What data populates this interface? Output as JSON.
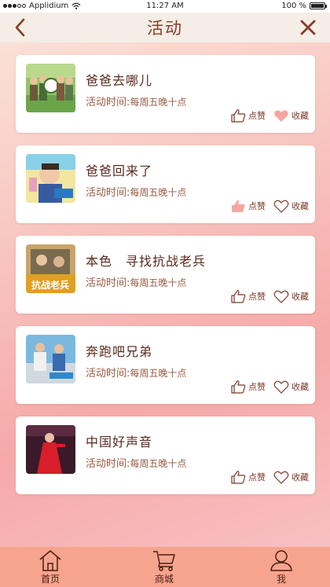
{
  "status_bar": {
    "carrier": "Applidium",
    "time": "11:27 AM",
    "battery": "100 %"
  },
  "header": {
    "title": "活动"
  },
  "activities": [
    {
      "title": "爸爸去哪儿",
      "time_label": "活动时间:",
      "time_value": "每周五晚十点",
      "like_label": "点赞",
      "fav_label": "收藏",
      "liked": false,
      "favorited": true
    },
    {
      "title": "爸爸回来了",
      "time_label": "活动时间:",
      "time_value": "每周五晚十点",
      "like_label": "点赞",
      "fav_label": "收藏",
      "liked": true,
      "favorited": false
    },
    {
      "title": "本色　寻找抗战老兵",
      "time_label": "活动时间:",
      "time_value": "每周五晚十点",
      "like_label": "点赞",
      "fav_label": "收藏",
      "liked": false,
      "favorited": false
    },
    {
      "title": "奔跑吧兄弟",
      "time_label": "活动时间:",
      "time_value": "每周五晚十点",
      "like_label": "点赞",
      "fav_label": "收藏",
      "liked": false,
      "favorited": false
    },
    {
      "title": "中国好声音",
      "time_label": "活动时间:",
      "time_value": "每周五晚十点",
      "like_label": "点赞",
      "fav_label": "收藏",
      "liked": false,
      "favorited": false
    }
  ],
  "thumb_text": {
    "anti_war": "抗战老兵"
  },
  "tabs": [
    {
      "label": "首页",
      "icon": "home-icon"
    },
    {
      "label": "商城",
      "icon": "cart-icon"
    },
    {
      "label": "我",
      "icon": "user-icon"
    }
  ],
  "colors": {
    "accent": "#8a3a28",
    "tabbar": "#f6a48e",
    "heart_filled": "#f4a7a0",
    "thumb_filled": "#f4a7a0"
  }
}
